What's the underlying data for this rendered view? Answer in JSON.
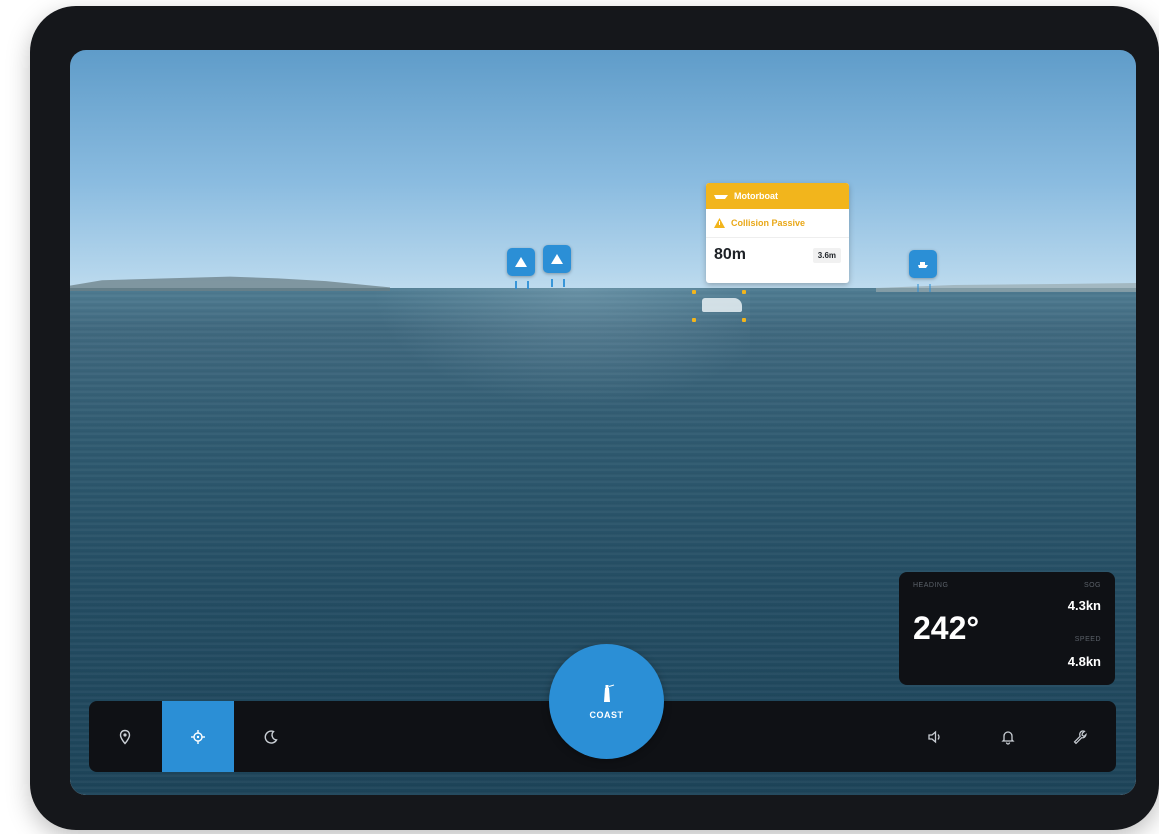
{
  "target_card": {
    "vessel_type": "Motorboat",
    "alert": "Collision Passive",
    "distance": "80m",
    "time": "3.6m"
  },
  "nav_panel": {
    "heading_label": "HEADING",
    "heading": "242°",
    "speed_label": "SOG",
    "speed": "4.3kn",
    "range_label": "SPEED",
    "range": "4.8kn"
  },
  "toolbar": {
    "items": [
      {
        "name": "waypoint",
        "icon": "map-pin-icon",
        "active": false
      },
      {
        "name": "target",
        "icon": "crosshair-icon",
        "active": true
      },
      {
        "name": "night-mode",
        "icon": "moon-icon",
        "active": false
      }
    ],
    "right_items": [
      {
        "name": "sound",
        "icon": "speaker-icon"
      },
      {
        "name": "alerts",
        "icon": "bell-icon"
      },
      {
        "name": "settings",
        "icon": "wrench-icon"
      }
    ],
    "mode_button_label": "COAST"
  },
  "colors": {
    "accent": "#2b8fd6",
    "warning": "#f2b51c",
    "panel": "#0f1115",
    "frame": "#15171b"
  }
}
